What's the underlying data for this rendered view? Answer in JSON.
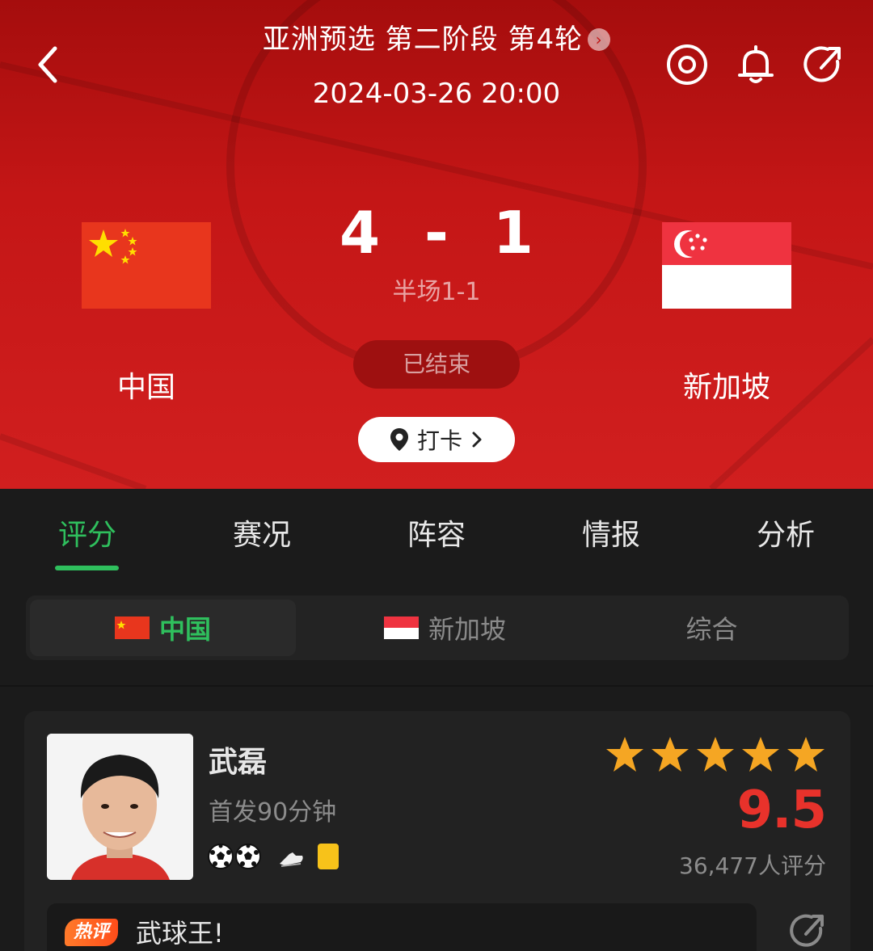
{
  "header": {
    "competition": "亚洲预选 第二阶段 第4轮",
    "datetime": "2024-03-26 20:00",
    "icons": [
      "back-icon",
      "target-icon",
      "bell-icon",
      "share-icon"
    ]
  },
  "match": {
    "home_team": "中国",
    "away_team": "新加坡",
    "home_score": "4",
    "separator": "-",
    "away_score": "1",
    "half_time": "半场1-1",
    "status": "已结束",
    "checkin_label": "打卡"
  },
  "tabs": [
    "评分",
    "赛况",
    "阵容",
    "情报",
    "分析"
  ],
  "active_tab": 0,
  "team_filter": {
    "items": [
      "中国",
      "新加坡",
      "综合"
    ],
    "active": 0
  },
  "player": {
    "name": "武磊",
    "minutes": "首发90分钟",
    "events": [
      "goal-icon",
      "goal-icon",
      "boot-assist-icon",
      "yellow-card-icon"
    ],
    "stars": 5,
    "rating": "9.5",
    "rating_count": "36,477人评分",
    "hot_comment_tag": "热评",
    "hot_comment": "武球王!"
  },
  "colors": {
    "accent_green": "#2fbf5d",
    "hero_red": "#c41616",
    "rating_red": "#e8322b",
    "star_orange": "#f5a623"
  }
}
